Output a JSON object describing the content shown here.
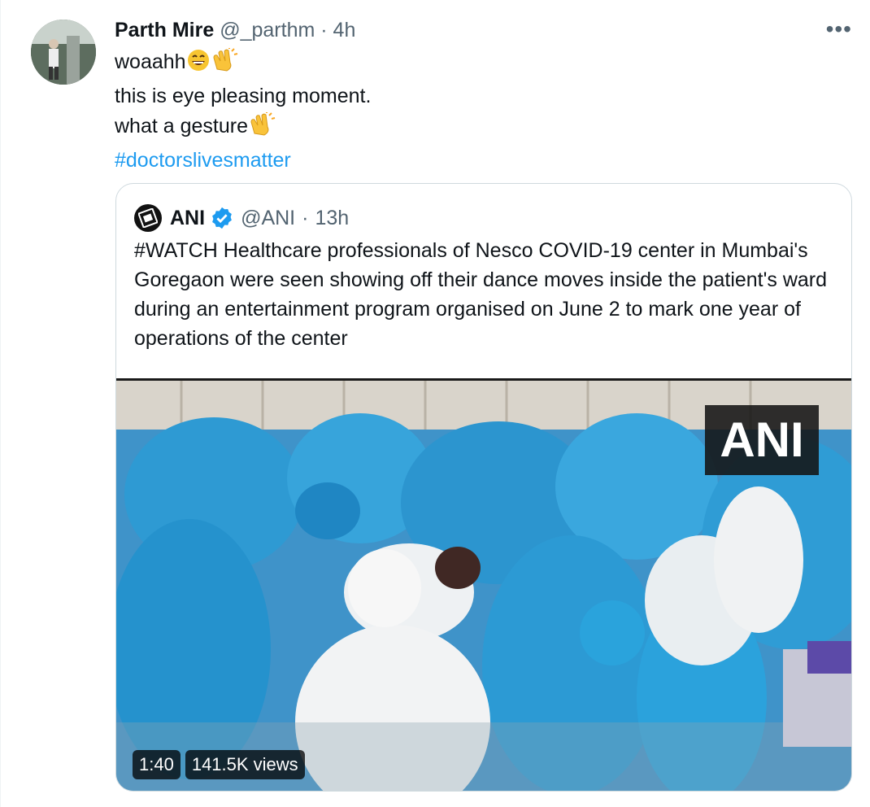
{
  "tweet": {
    "display_name": "Parth Mire",
    "handle": "@_parthm",
    "separator": "·",
    "time": "4h",
    "more_label": "•••",
    "line1": "woaahh",
    "line2": "this is eye pleasing moment.",
    "line3": "what a gesture",
    "hashtag": "#doctorslivesmatter"
  },
  "quoted": {
    "display_name": "ANI",
    "handle": "@ANI",
    "separator": "·",
    "time": "13h",
    "text": "#WATCH Healthcare professionals of Nesco COVID-19 center in Mumbai's Goregaon were seen showing off their dance moves inside the patient's ward during an entertainment program organised on June 2 to mark one year of operations of the center",
    "video": {
      "watermark": "ANI",
      "duration": "1:40",
      "views": "141.5K views"
    }
  },
  "colors": {
    "text": "#0f1419",
    "muted": "#536471",
    "link": "#1d9bf0",
    "verified": "#1d9bf0",
    "border": "#cfd9de",
    "ppe_blue": "#2aa3dc"
  }
}
